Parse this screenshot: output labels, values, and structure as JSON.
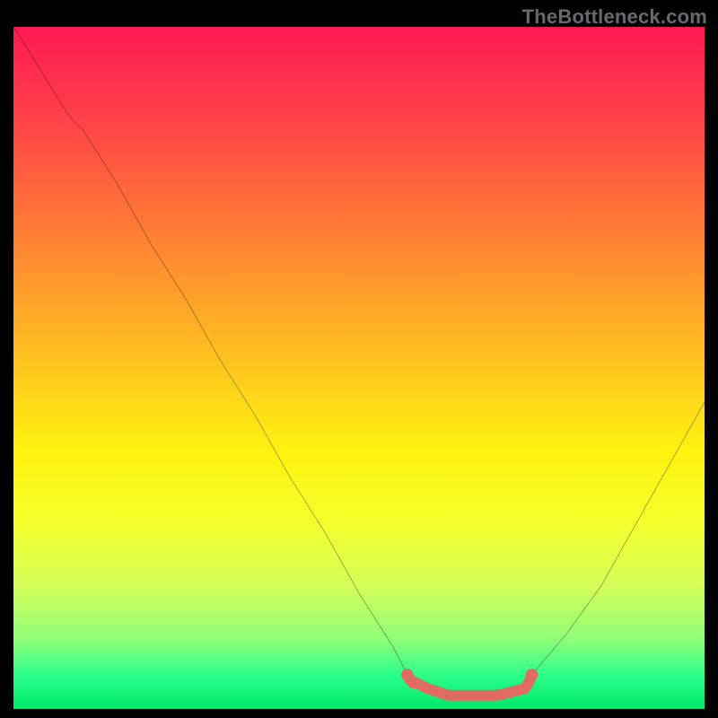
{
  "watermark": "TheBottleneck.com",
  "colors": {
    "background": "#000000",
    "watermark_text": "#666a6e",
    "curve_line": "#000000",
    "highlight_stroke": "#e06b62",
    "gradient_stops": [
      "#ff1a52",
      "#ff3c4a",
      "#ff6b3a",
      "#ff9a2c",
      "#ffc71e",
      "#fff210",
      "#f7ff2a",
      "#d4ff5a",
      "#8cff7a",
      "#2cff8a",
      "#00e86a"
    ]
  },
  "chart_data": {
    "type": "line",
    "title": "",
    "xlabel": "",
    "ylabel": "",
    "xlim": [
      0,
      100
    ],
    "ylim": [
      0,
      100
    ],
    "grid": false,
    "series": [
      {
        "name": "bottleneck-curve",
        "x": [
          0,
          5,
          10,
          15,
          20,
          25,
          30,
          35,
          40,
          45,
          50,
          55,
          57,
          58,
          60,
          63,
          66,
          70,
          74,
          75,
          80,
          85,
          90,
          95,
          100
        ],
        "y": [
          100,
          94,
          85,
          77,
          68,
          60,
          51,
          43,
          34,
          26,
          17,
          9,
          5,
          4,
          3,
          2,
          2,
          2,
          3,
          5,
          11,
          18,
          27,
          36,
          45
        ],
        "color": "#000000"
      }
    ],
    "annotations": [
      {
        "name": "optimal-zone-highlight",
        "type": "segment",
        "x": [
          57,
          58,
          60,
          63,
          66,
          70,
          74,
          75
        ],
        "y": [
          5,
          4,
          3,
          2,
          2,
          2,
          3,
          5
        ],
        "color": "#e06b62",
        "stroke_width": 12
      }
    ]
  }
}
